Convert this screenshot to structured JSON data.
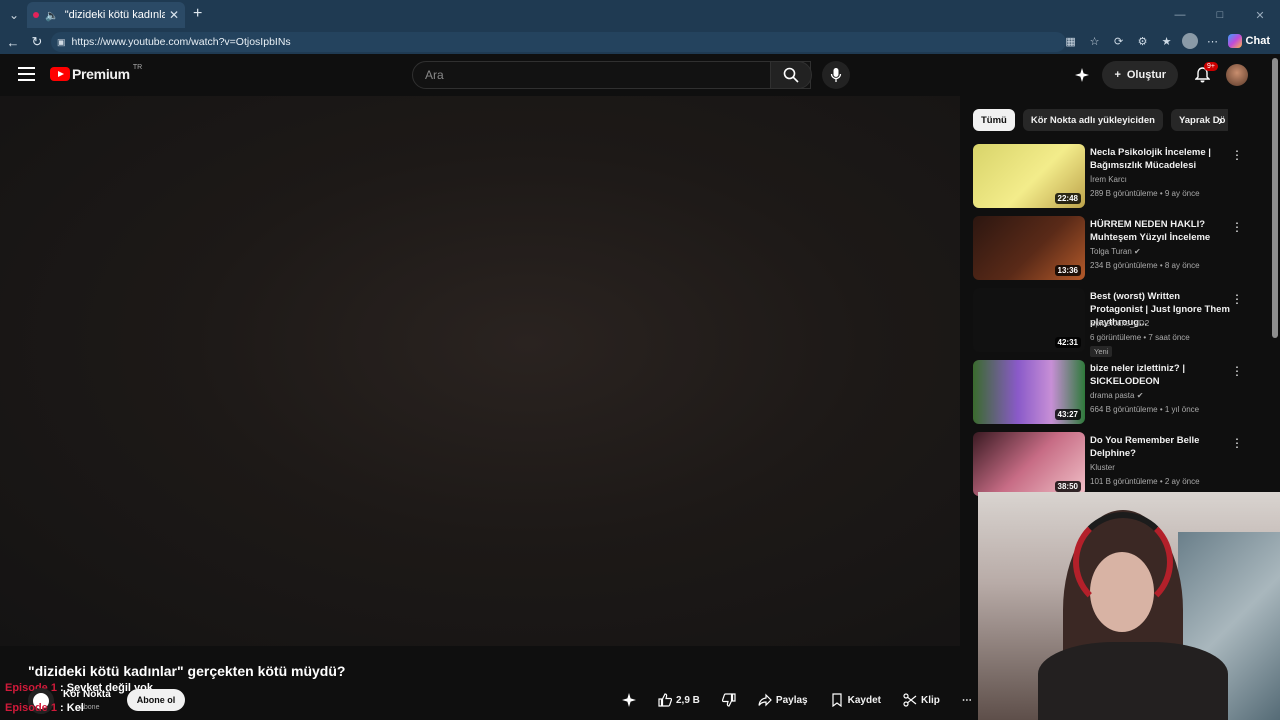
{
  "browser": {
    "tab_title": "\"dizideki kötü kadınlar\" gerçe",
    "url": "https://www.youtube.com/watch?v=OtjosIpbINs",
    "chat_label": "Chat"
  },
  "masthead": {
    "logo_text": "Premium",
    "region": "TR",
    "search_placeholder": "Ara",
    "create_label": "Oluştur",
    "notification_count": "9+"
  },
  "video": {
    "title": "\"dizideki kötü kadınlar\" gerçekten kötü müydü?",
    "overlay_lines": [
      {
        "ep": "Episode 1",
        "text": " : Şevket değil yok"
      },
      {
        "ep": "Episode 1",
        "text": " : Kel"
      }
    ],
    "channel_name": "Kör Nokta",
    "subscribers": "abone",
    "subscribe_label": "Abone ol",
    "like_count": "2,9 B",
    "share_label": "Paylaş",
    "save_label": "Kaydet",
    "clip_label": "Klip"
  },
  "chips": [
    "Tümü",
    "Kör Nokta adlı yükleyiciden",
    "Yaprak Dö"
  ],
  "recommendations": [
    {
      "title": "Necla Psikolojik İnceleme | Bağımsızlık Mücadelesi",
      "channel": "İrem Karcı",
      "meta": "289 B görüntüleme • 9 ay önce",
      "duration": "22:48",
      "verified": false,
      "badge": ""
    },
    {
      "title": "HÜRREM NEDEN HAKLI? Muhteşem Yüzyıl İnceleme",
      "channel": "Tolga Turan",
      "meta": "234 B görüntüleme • 8 ay önce",
      "duration": "13:36",
      "verified": true,
      "badge": ""
    },
    {
      "title": "Best (worst) Written Protagonist | Just Ignore Them playthroug...",
      "channel": "SpiderJake_3D2",
      "meta": "6 görüntüleme • 7 saat önce",
      "duration": "42:31",
      "verified": false,
      "badge": "Yeni"
    },
    {
      "title": "bize neler izlettiniz? | SICKELODEON",
      "channel": "drama pasta",
      "meta": "664 B görüntüleme • 1 yıl önce",
      "duration": "43:27",
      "verified": true,
      "badge": ""
    },
    {
      "title": "Do You Remember Belle Delphine?",
      "channel": "Kluster",
      "meta": "101 B görüntüleme • 2 ay önce",
      "duration": "38:50",
      "verified": false,
      "badge": ""
    }
  ],
  "colors": {
    "brand": "#ff0000",
    "episode": "#d01a3a",
    "chrome": "#1f3a52"
  }
}
